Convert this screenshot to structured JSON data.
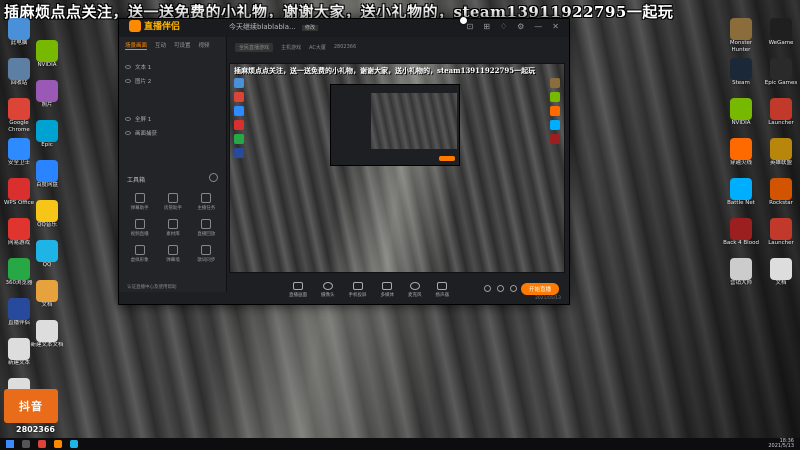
{
  "banner": {
    "text": "插麻烦点点关注，送一送免费的小礼物，谢谢大家，送小礼物的，steam13911922795一起玩"
  },
  "desktop": {
    "left_col1": [
      {
        "label": "此电脑",
        "icon": "computer-icon",
        "color": "#4a90d9"
      },
      {
        "label": "回收站",
        "icon": "recycle-bin-icon",
        "color": "#5c7fa3"
      },
      {
        "label": "Google Chrome",
        "icon": "chrome-icon",
        "color": "#db4437"
      },
      {
        "label": "安全卫士",
        "icon": "shield-icon",
        "color": "#2e8bff"
      },
      {
        "label": "WPS Office",
        "icon": "wps-icon",
        "color": "#d9302f"
      },
      {
        "label": "网易游戏",
        "icon": "game-icon",
        "color": "#e0342e"
      },
      {
        "label": "360浏览器",
        "icon": "browser-icon",
        "color": "#27a844"
      },
      {
        "label": "直播伴侣",
        "icon": "live-icon",
        "color": "#284a9c"
      },
      {
        "label": "新建文本",
        "icon": "file-icon",
        "color": "#dddddd"
      },
      {
        "label": "3000",
        "icon": "file-icon",
        "color": "#dddddd"
      }
    ],
    "left_col2": [
      {
        "label": "NVIDIA",
        "icon": "nvidia-icon",
        "color": "#76b900"
      },
      {
        "label": "照片",
        "icon": "photos-icon",
        "color": "#9b59b6"
      },
      {
        "label": "Epic",
        "icon": "epic-icon",
        "color": "#00a2d2"
      },
      {
        "label": "百度网盘",
        "icon": "cloud-icon",
        "color": "#2a84ff"
      },
      {
        "label": "QQ音乐",
        "icon": "music-icon",
        "color": "#f5c518"
      },
      {
        "label": "QQ",
        "icon": "qq-icon",
        "color": "#1fb4e6"
      },
      {
        "label": "文档",
        "icon": "doc-icon",
        "color": "#e6a23c"
      },
      {
        "label": "新建文本文档",
        "icon": "file-icon",
        "color": "#dddddd"
      }
    ],
    "right_col1": [
      {
        "label": "Monster Hunter",
        "icon": "game-icon",
        "color": "#8a6d3b"
      },
      {
        "label": "Steam",
        "icon": "steam-icon",
        "color": "#1b2838"
      },
      {
        "label": "NVIDIA",
        "icon": "nvidia-icon",
        "color": "#76b900"
      },
      {
        "label": "穿越火线",
        "icon": "game-icon",
        "color": "#ff6a00"
      },
      {
        "label": "Battle Net",
        "icon": "battle-icon",
        "color": "#00aeff"
      },
      {
        "label": "Back 4 Blood",
        "icon": "game-icon",
        "color": "#9c1f1f"
      },
      {
        "label": "营销大师",
        "icon": "app-icon",
        "color": "#cccccc"
      }
    ],
    "right_col2": [
      {
        "label": "WeGame",
        "icon": "wegame-icon",
        "color": "#1f1f1f"
      },
      {
        "label": "Epic Games",
        "icon": "epic-icon",
        "color": "#2a2a2a"
      },
      {
        "label": "Launcher",
        "icon": "launcher-icon",
        "color": "#c0392b"
      },
      {
        "label": "英雄联盟",
        "icon": "lol-icon",
        "color": "#b8860b"
      },
      {
        "label": "Rockstar",
        "icon": "rockstar-icon",
        "color": "#d35400"
      },
      {
        "label": "Launcher",
        "icon": "launcher-icon",
        "color": "#c0392b"
      },
      {
        "label": "文档",
        "icon": "file-icon",
        "color": "#dddddd"
      }
    ],
    "viewer_count": "2802366",
    "logo_badge": "抖音"
  },
  "app": {
    "logo_text": "直播伴侣",
    "title": "今天继续blablabla...",
    "edit_tag": "修改",
    "header2": [
      "全民直播游戏",
      "主机游戏",
      "AC大厦",
      "2802366"
    ],
    "sidebar_tabs": [
      "场景画面",
      "互动",
      "可设置",
      "视频"
    ],
    "scenes": [
      "文本 1",
      "图片 2",
      "全屏 1",
      "画面捕获"
    ],
    "toolbox_title": "工具箱",
    "tools": [
      "弹幕助手",
      "房管助手",
      "主播任务",
      "视频直播",
      "素材库",
      "直播回放",
      "虚拟形象",
      "弹幕墙",
      "歌词同步"
    ],
    "sidebar_footer": "认证直播中心及使用帮助",
    "control_items": [
      "直播画面",
      "摄像头",
      "手机投屏",
      "多媒体",
      "麦克风",
      "扬声器"
    ],
    "live_button": "开始直播",
    "status_left": "",
    "status_right": "2021/05/13"
  },
  "taskbar": {
    "time": "18:36",
    "date": "2021/5/13"
  }
}
